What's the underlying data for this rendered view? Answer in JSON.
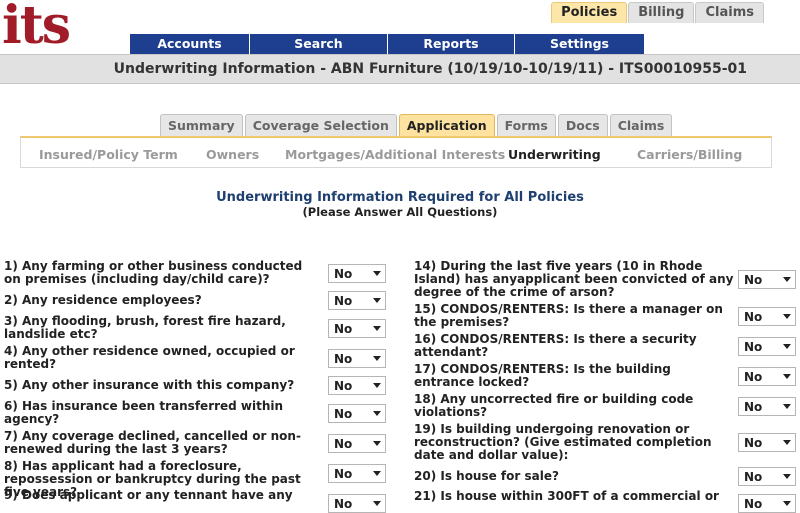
{
  "brand": {
    "logo_text": "its",
    "logo_color": "#a01c28"
  },
  "top_tabs": [
    {
      "label": "Policies",
      "active": true
    },
    {
      "label": "Billing",
      "active": false
    },
    {
      "label": "Claims",
      "active": false
    }
  ],
  "nav": [
    {
      "label": "Accounts"
    },
    {
      "label": "Search"
    },
    {
      "label": "Reports"
    },
    {
      "label": "Settings"
    }
  ],
  "title": "Underwriting Information - ABN Furniture (10/19/10-10/19/11) - ITS00010955-01",
  "sub_tabs": [
    {
      "label": "Summary",
      "active": false
    },
    {
      "label": "Coverage Selection",
      "active": false
    },
    {
      "label": "Application",
      "active": true
    },
    {
      "label": "Forms",
      "active": false
    },
    {
      "label": "Docs",
      "active": false
    },
    {
      "label": "Claims",
      "active": false
    }
  ],
  "section_links": [
    {
      "label": "Insured/Policy Term",
      "active": false
    },
    {
      "label": "Owners",
      "active": false
    },
    {
      "label": "Mortgages/Additional Interests",
      "active": false
    },
    {
      "label": "Underwriting",
      "active": true
    },
    {
      "label": "Carriers/Billing",
      "active": false
    }
  ],
  "heading": "Underwriting Information Required for All Policies",
  "subheading": "(Please Answer All Questions)",
  "left_questions": [
    {
      "text": "1) Any farming or other business conducted on premises (including day/child care)?",
      "value": "No"
    },
    {
      "text": "2) Any residence employees?",
      "value": "No"
    },
    {
      "text": "3) Any flooding, brush, forest fire hazard, landslide etc?",
      "value": "No"
    },
    {
      "text": "4) Any other residence owned, occupied or rented?",
      "value": "No"
    },
    {
      "text": "5) Any other insurance with this company?",
      "value": "No"
    },
    {
      "text": "6) Has insurance been transferred within agency?",
      "value": "No"
    },
    {
      "text": "7) Any coverage declined, cancelled or non-renewed during the last 3 years?",
      "value": "No"
    },
    {
      "text": "8) Has applicant had a foreclosure, repossession or bankruptcy during the past five years?",
      "value": "No"
    },
    {
      "text": "9) Does applicant or any tennant have any",
      "value": "No"
    }
  ],
  "right_questions": [
    {
      "text": "14) During the last five years (10 in Rhode Island) has anyapplicant been convicted of any degree of the crime of arson?",
      "value": "No"
    },
    {
      "text": "15) CONDOS/RENTERS: Is there a manager on the premises?",
      "value": "No"
    },
    {
      "text": "16) CONDOS/RENTERS: Is there a security attendant?",
      "value": "No"
    },
    {
      "text": "17) CONDOS/RENTERS: Is the building entrance locked?",
      "value": "No"
    },
    {
      "text": "18) Any uncorrected fire or building code violations?",
      "value": "No"
    },
    {
      "text": "19) Is building undergoing renovation or reconstruction? (Give estimated completion date and dollar value):",
      "value": "No"
    },
    {
      "text": "20) Is house for sale?",
      "value": "No"
    },
    {
      "text": "21) Is house within 300FT of a commercial or",
      "value": "No"
    }
  ]
}
